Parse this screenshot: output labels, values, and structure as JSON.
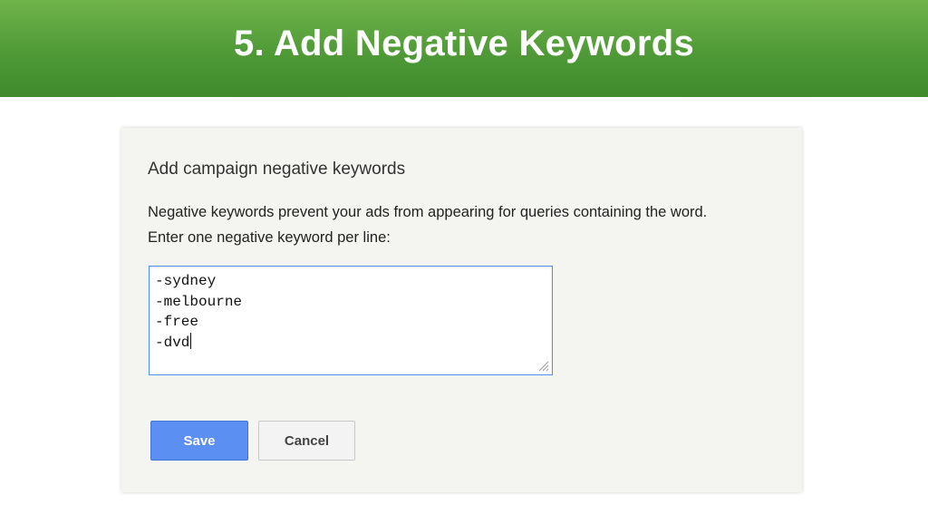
{
  "slide": {
    "title": "5. Add Negative Keywords"
  },
  "dialog": {
    "heading": "Add campaign negative keywords",
    "description_line1": "Negative keywords prevent your ads from appearing for queries containing the word.",
    "description_line2": "Enter one negative keyword per line:",
    "keywords": [
      "-sydney",
      "-melbourne",
      "-free",
      "-dvd"
    ],
    "buttons": {
      "save_label": "Save",
      "cancel_label": "Cancel"
    }
  },
  "colors": {
    "banner_green": "#4f9a37",
    "save_blue": "#5b8ff2",
    "focus_blue": "#4d90fe",
    "panel_bg": "#f4f5f1"
  },
  "icons": {
    "resize": "resize-grip-icon"
  }
}
